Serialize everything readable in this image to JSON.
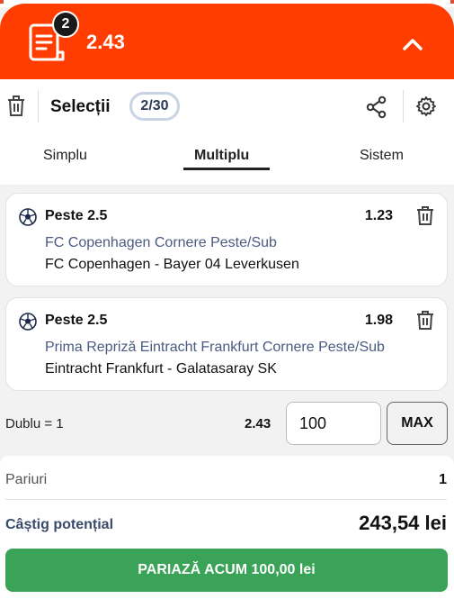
{
  "header": {
    "badge_count": "2",
    "total_odds": "2.43",
    "icons": {
      "slip": "bet-slip-icon",
      "collapse": "chevron-up-icon"
    }
  },
  "panel": {
    "title": "Selecții",
    "count": "2/30",
    "icons": {
      "clear": "trash-icon",
      "share": "share-icon",
      "settings": "gear-icon"
    }
  },
  "tabs": [
    {
      "label": "Simplu",
      "active": false
    },
    {
      "label": "Multiplu",
      "active": true
    },
    {
      "label": "Sistem",
      "active": false
    }
  ],
  "selections": [
    {
      "pick": "Peste 2.5",
      "odd": "1.23",
      "market": "FC Copenhagen Cornere Peste/Sub",
      "event": "FC Copenhagen - Bayer 04 Leverkusen"
    },
    {
      "pick": "Peste 2.5",
      "odd": "1.98",
      "market": "Prima Repriză Eintracht Frankfurt Cornere Peste/Sub",
      "event": "Eintracht Frankfurt - Galatasaray SK"
    }
  ],
  "stake": {
    "label": "Dublu = 1",
    "odds": "2.43",
    "amount": "100",
    "max_label": "MAX"
  },
  "summary": {
    "bets_label": "Pariuri",
    "bets_value": "1",
    "win_label": "Câștig potențial",
    "win_value": "243,54 lei",
    "cta_label": "PARIAZĂ ACUM 100,00 lei"
  },
  "colors": {
    "brand": "#ff3d00",
    "cta": "#3aa357",
    "market_text": "#4a5a80"
  }
}
